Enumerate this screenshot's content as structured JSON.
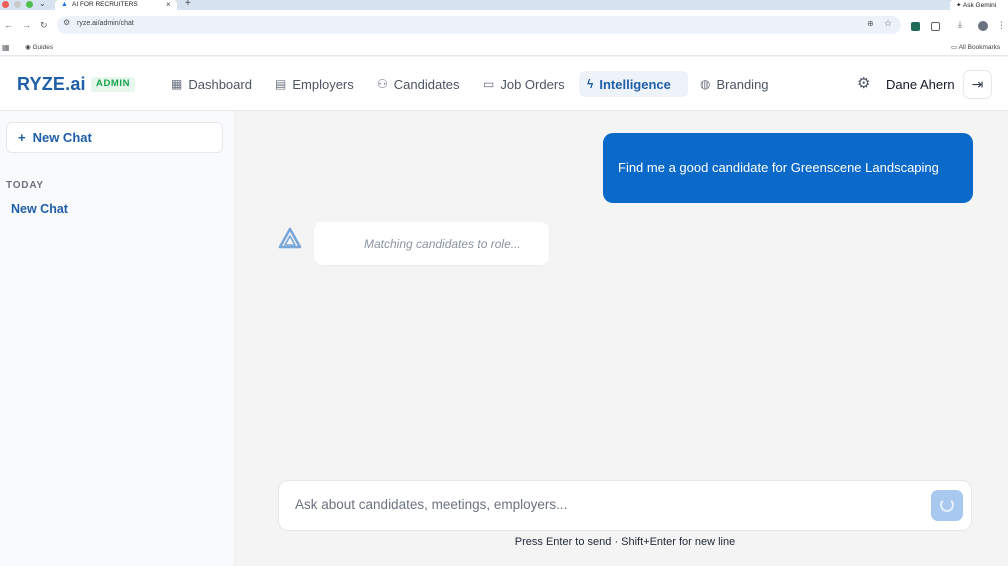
{
  "browser": {
    "tab_title": "AI FOR RECRUITERS",
    "new_tab": "+",
    "ask_gemini": "Ask Gemini",
    "url": "ryze.ai/admin/chat",
    "bookmark_guides": "Guides",
    "all_bookmarks": "All Bookmarks"
  },
  "header": {
    "logo": "RYZE.ai",
    "badge": "ADMIN",
    "nav": [
      {
        "label": "Dashboard",
        "icon": "grid-icon",
        "active": false
      },
      {
        "label": "Employers",
        "icon": "building-icon",
        "active": false
      },
      {
        "label": "Candidates",
        "icon": "users-icon",
        "active": false
      },
      {
        "label": "Job Orders",
        "icon": "briefcase-icon",
        "active": false
      },
      {
        "label": "Intelligence",
        "icon": "bolt-icon",
        "active": true
      },
      {
        "label": "Branding",
        "icon": "palette-icon",
        "active": false
      }
    ],
    "user_name": "Dane Ahern"
  },
  "sidebar": {
    "new_chat_label": "New Chat",
    "section_label": "TODAY",
    "chats": [
      {
        "label": "New Chat"
      }
    ]
  },
  "conversation": {
    "user_message": "Find me a good candidate for Greenscene Landscaping",
    "assistant_status": "Matching candidates to role..."
  },
  "composer": {
    "placeholder": "Ask about candidates, meetings, employers...",
    "hint": "Press Enter to send · Shift+Enter for new line"
  },
  "colors": {
    "brand": "#1f5ea8",
    "user_bubble": "#0b69c9",
    "admin_badge": "#16a34a",
    "send_button": "#a8c8ef"
  }
}
